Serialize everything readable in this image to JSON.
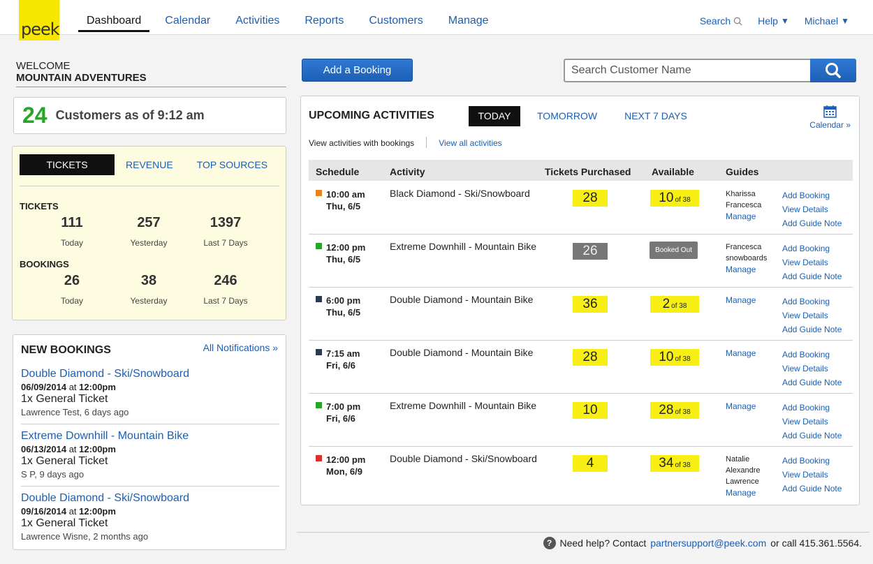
{
  "logo": {
    "text": "peek"
  },
  "nav": {
    "items": [
      "Dashboard",
      "Calendar",
      "Activities",
      "Reports",
      "Customers",
      "Manage"
    ],
    "search": "Search",
    "help": "Help",
    "user": "Michael"
  },
  "welcome": {
    "line1": "WELCOME",
    "line2": "MOUNTAIN ADVENTURES"
  },
  "customers": {
    "count": "24",
    "label": "Customers as of 9:12 am"
  },
  "stats": {
    "tabs": [
      "TICKETS",
      "REVENUE",
      "TOP SOURCES"
    ],
    "tickets_label": "TICKETS",
    "tickets": [
      {
        "value": "111",
        "label": "Today"
      },
      {
        "value": "257",
        "label": "Yesterday"
      },
      {
        "value": "1397",
        "label": "Last 7 Days"
      }
    ],
    "bookings_label": "BOOKINGS",
    "bookings": [
      {
        "value": "26",
        "label": "Today"
      },
      {
        "value": "38",
        "label": "Yesterday"
      },
      {
        "value": "246",
        "label": "Last 7 Days"
      }
    ]
  },
  "new_bookings": {
    "title": "NEW BOOKINGS",
    "all_link": "All Notifications »",
    "items": [
      {
        "name": "Double Diamond - Ski/Snowboard",
        "date": "06/09/2014",
        "at": "at",
        "time": "12:00pm",
        "ticket": "1x General Ticket",
        "who": "Lawrence Test, 6 days ago"
      },
      {
        "name": "Extreme Downhill - Mountain Bike",
        "date": "06/13/2014",
        "at": "at",
        "time": "12:00pm",
        "ticket": "1x General Ticket",
        "who": "S P, 9 days ago"
      },
      {
        "name": "Double Diamond - Ski/Snowboard",
        "date": "09/16/2014",
        "at": "at",
        "time": "12:00pm",
        "ticket": "1x General Ticket",
        "who": "Lawrence Wisne, 2 months ago"
      }
    ]
  },
  "actions": {
    "add_booking": "Add a Booking",
    "search_placeholder": "Search Customer Name"
  },
  "upcoming": {
    "title": "UPCOMING ACTIVITIES",
    "tabs": [
      "TODAY",
      "TOMORROW",
      "NEXT 7 DAYS"
    ],
    "calendar_link": "Calendar »",
    "view_with_bookings": "View activities with bookings",
    "view_all": "View all activities",
    "headers": [
      "Schedule",
      "Activity",
      "Tickets Purchased",
      "Available",
      "Guides"
    ],
    "rows": [
      {
        "color": "#e8821e",
        "time": "10:00 am",
        "day": "Thu, 6/5",
        "activity": "Black Diamond - Ski/Snowboard",
        "tickets": "28",
        "available": "10",
        "of": "of 38",
        "booked_out": "",
        "guides": [
          "Kharissa",
          "Francesca"
        ],
        "manage": "Manage",
        "links": [
          "Add Booking",
          "View Details",
          "Add Guide Note"
        ]
      },
      {
        "color": "#2aa52a",
        "time": "12:00 pm",
        "day": "Thu, 6/5",
        "activity": "Extreme Downhill - Mountain Bike",
        "tickets": "26",
        "available": "",
        "of": "",
        "booked_out": "Booked Out",
        "guides": [
          "Francesca",
          "snowboards"
        ],
        "manage": "Manage",
        "links": [
          "Add Booking",
          "View Details",
          "Add Guide Note"
        ]
      },
      {
        "color": "#2b3a4e",
        "time": "6:00 pm",
        "day": "Thu, 6/5",
        "activity": "Double Diamond - Mountain Bike",
        "tickets": "36",
        "available": "2",
        "of": "of 38",
        "booked_out": "",
        "guides": [],
        "manage": "Manage",
        "links": [
          "Add Booking",
          "View Details",
          "Add Guide Note"
        ]
      },
      {
        "color": "#2b3a4e",
        "time": "7:15 am",
        "day": "Fri, 6/6",
        "activity": "Double Diamond - Mountain Bike",
        "tickets": "28",
        "available": "10",
        "of": "of 38",
        "booked_out": "",
        "guides": [],
        "manage": "Manage",
        "links": [
          "Add Booking",
          "View Details",
          "Add Guide Note"
        ]
      },
      {
        "color": "#2aa52a",
        "time": "7:00 pm",
        "day": "Fri, 6/6",
        "activity": "Extreme Downhill - Mountain Bike",
        "tickets": "10",
        "available": "28",
        "of": "of 38",
        "booked_out": "",
        "guides": [],
        "manage": "Manage",
        "links": [
          "Add Booking",
          "View Details",
          "Add Guide Note"
        ]
      },
      {
        "color": "#d9302a",
        "time": "12:00 pm",
        "day": "Mon, 6/9",
        "activity": "Double Diamond - Ski/Snowboard",
        "tickets": "4",
        "available": "34",
        "of": "of 38",
        "booked_out": "",
        "guides": [
          "Natalie",
          "Alexandre",
          "Lawrence"
        ],
        "manage": "Manage",
        "links": [
          "Add Booking",
          "View Details",
          "Add Guide Note"
        ]
      }
    ]
  },
  "footer": {
    "pre": "Need help? Contact",
    "email": "partnersupport@peek.com",
    "post": "or call 415.361.5564."
  }
}
